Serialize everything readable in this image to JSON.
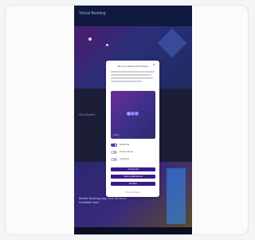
{
  "app": {
    "title": "Virtual Banking"
  },
  "section_text": "Get Started",
  "promo_text": "Mobile Banking App and Services Available Now",
  "modal": {
    "title": "We use cookies and tracking",
    "preview_caption": "Video",
    "toggles": [
      {
        "label": "Essential",
        "on": true
      },
      {
        "label": "Performance",
        "on": false
      },
      {
        "label": "Analytics",
        "on": false
      }
    ],
    "buttons": [
      {
        "label": "Accept all"
      },
      {
        "label": "Save preferences"
      },
      {
        "label": "Decline"
      }
    ],
    "footer": "Privacy Policy"
  },
  "colors": {
    "accent": "#3b1b8c",
    "toggle_on": "#6b2dbf",
    "phone_bg": "#0e1633"
  }
}
